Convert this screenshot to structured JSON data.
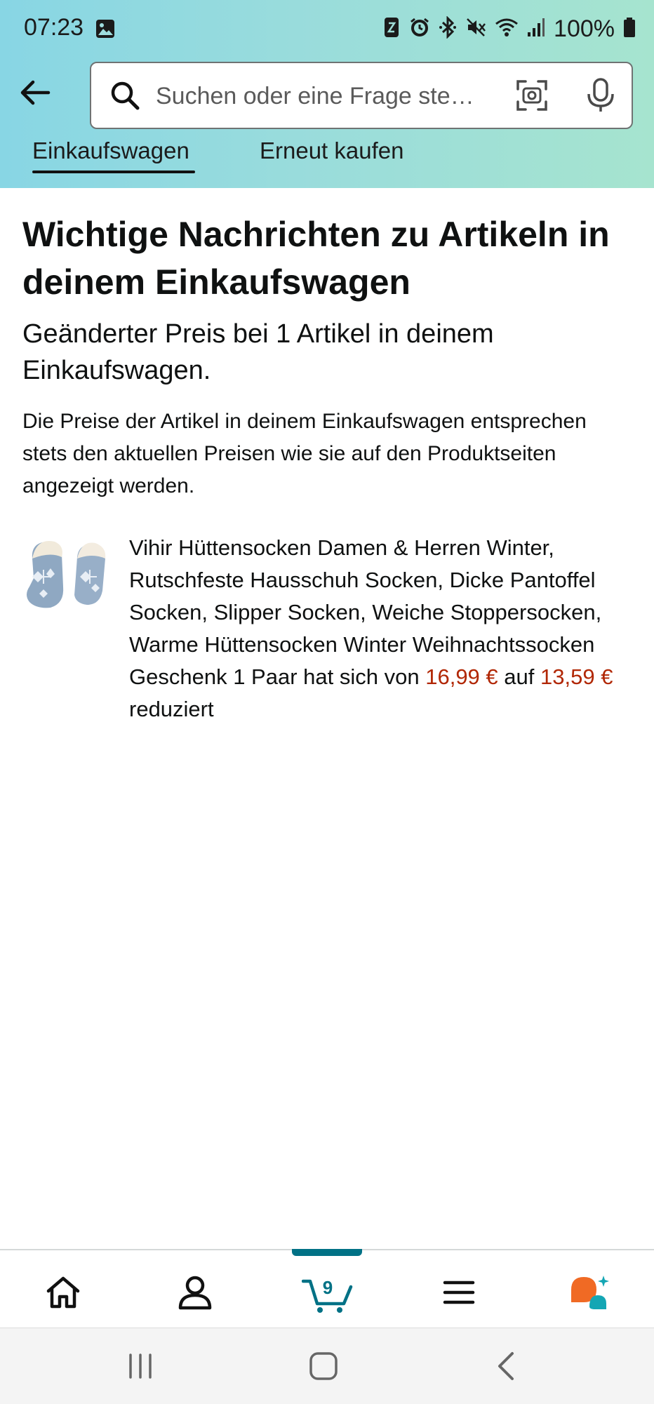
{
  "status_bar": {
    "time": "07:23",
    "battery": "100%",
    "icons": [
      "image-icon",
      "nfc-icon",
      "alarm-icon",
      "bluetooth-icon",
      "mute-icon",
      "wifi-icon",
      "signal-icon",
      "battery-icon"
    ]
  },
  "header": {
    "search": {
      "placeholder": "Suchen oder eine Frage ste…"
    },
    "tabs": [
      {
        "label": "Einkaufswagen",
        "active": true
      },
      {
        "label": "Erneut kaufen",
        "active": false
      }
    ]
  },
  "main": {
    "title": "Wichtige Nachrichten zu Artikeln in deinem Einkaufswagen",
    "subtitle": "Geänderter Preis bei 1 Artikel in deinem Einkaufswagen.",
    "info": "Die Preise der Artikel in deinem Einkaufswagen entsprechen stets den aktuellen Preisen wie sie auf den Produktseiten angezeigt werden.",
    "product": {
      "description": "Vihir Hüttensocken Damen & Herren Winter, Rutschfeste Hausschuh Socken, Dicke Pantoffel Socken, Slipper Socken, Weiche Stoppersocken, Warme Hüttensocken Winter Weihnachtssocken Geschenk 1 Paar hat sich",
      "from_word": "von",
      "old_price": "16,99 €",
      "to_word": "auf",
      "new_price": "13,59 €",
      "suffix": "reduziert"
    }
  },
  "bottom_nav": {
    "items": [
      "home-icon",
      "account-icon",
      "cart-icon",
      "menu-icon",
      "rufus-icon"
    ],
    "cart_count": "9"
  },
  "colors": {
    "price": "#b12704",
    "accent": "#007185",
    "header_gradient_start": "#88d6e4",
    "header_gradient_end": "#a6e4cf",
    "rufus_orange": "#f06a24",
    "rufus_teal": "#14a6b4"
  }
}
